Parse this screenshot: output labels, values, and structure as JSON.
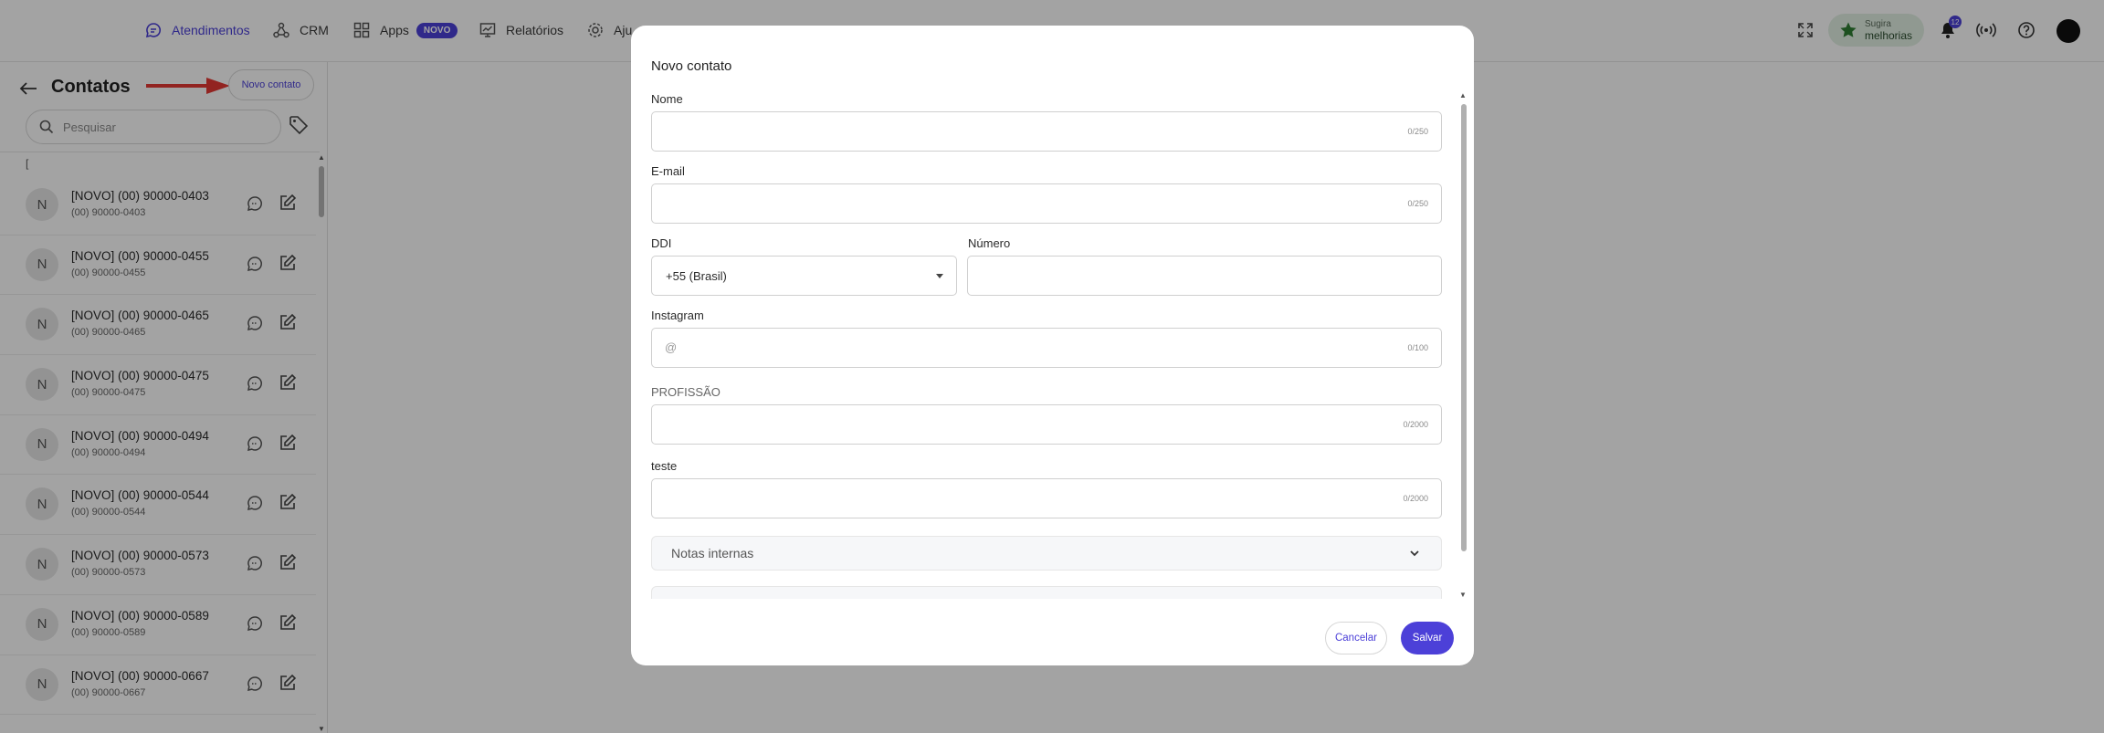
{
  "topnav": {
    "items": [
      {
        "label": "Atendimentos",
        "icon": "chat-bubble-icon",
        "active": true
      },
      {
        "label": "CRM",
        "icon": "crm-network-icon"
      },
      {
        "label": "Apps",
        "icon": "apps-grid-icon",
        "badge": "NOVO"
      },
      {
        "label": "Relatórios",
        "icon": "reports-chart-icon"
      },
      {
        "label": "Aju",
        "icon": "gear-icon"
      }
    ],
    "sugira": {
      "line1": "Sugira",
      "line2": "melhorias"
    },
    "notification_count": "12"
  },
  "left_panel": {
    "title": "Contatos",
    "new_contact_button": "Novo contato",
    "search_placeholder": "Pesquisar",
    "bracket": "[",
    "contacts": [
      {
        "initial": "N",
        "name": "[NOVO] (00) 90000-0403",
        "phone": "(00) 90000-0403"
      },
      {
        "initial": "N",
        "name": "[NOVO] (00) 90000-0455",
        "phone": "(00) 90000-0455"
      },
      {
        "initial": "N",
        "name": "[NOVO] (00) 90000-0465",
        "phone": "(00) 90000-0465"
      },
      {
        "initial": "N",
        "name": "[NOVO] (00) 90000-0475",
        "phone": "(00) 90000-0475"
      },
      {
        "initial": "N",
        "name": "[NOVO] (00) 90000-0494",
        "phone": "(00) 90000-0494"
      },
      {
        "initial": "N",
        "name": "[NOVO] (00) 90000-0544",
        "phone": "(00) 90000-0544"
      },
      {
        "initial": "N",
        "name": "[NOVO] (00) 90000-0573",
        "phone": "(00) 90000-0573"
      },
      {
        "initial": "N",
        "name": "[NOVO] (00) 90000-0589",
        "phone": "(00) 90000-0589"
      },
      {
        "initial": "N",
        "name": "[NOVO] (00) 90000-0667",
        "phone": "(00) 90000-0667"
      }
    ]
  },
  "modal": {
    "title": "Novo contato",
    "nome": {
      "label": "Nome",
      "value": "",
      "counter": "0/250"
    },
    "email": {
      "label": "E-mail",
      "value": "",
      "counter": "0/250"
    },
    "ddi": {
      "label": "DDI",
      "value": "+55 (Brasil)"
    },
    "numero": {
      "label": "Número",
      "value": ""
    },
    "instagram": {
      "label": "Instagram",
      "prefix": "@",
      "value": "",
      "counter": "0/100"
    },
    "profissao": {
      "label": "PROFISSÃO",
      "value": "",
      "counter": "0/2000"
    },
    "teste": {
      "label": "teste",
      "value": "",
      "counter": "0/2000"
    },
    "notas": {
      "label": "Notas internas"
    },
    "cancel": "Cancelar",
    "save": "Salvar"
  },
  "colors": {
    "accent": "#4c40d8",
    "arrow": "#e53935",
    "star": "#2e7d32"
  }
}
